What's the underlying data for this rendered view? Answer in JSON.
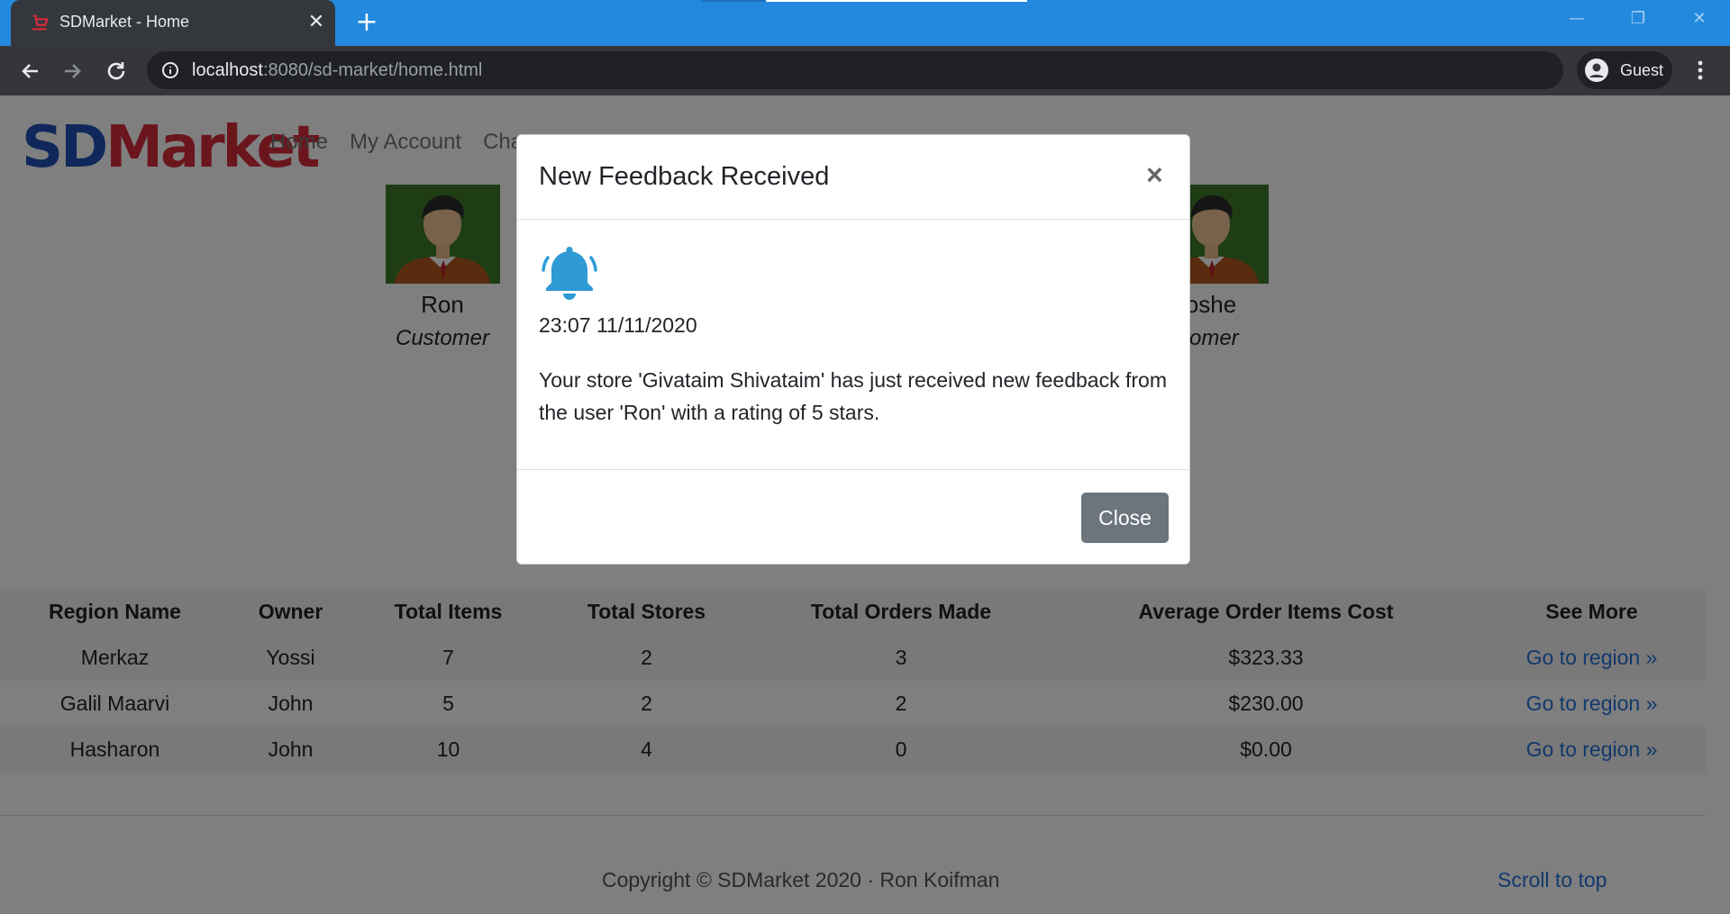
{
  "browser": {
    "tab_title": "SDMarket - Home",
    "url_host": "localhost",
    "url_rest": ":8080/sd-market/home.html",
    "profile_label": "Guest"
  },
  "site": {
    "logo_sd": "SD",
    "logo_market": "Market",
    "nav": [
      "Home",
      "My Account",
      "Cha"
    ]
  },
  "users": [
    {
      "name": "Ron",
      "role": "Customer"
    },
    {
      "name": "oshe",
      "role": "tomer"
    }
  ],
  "modal": {
    "title": "New Feedback Received",
    "time": "23:07 11/11/2020",
    "message": "Your store 'Givataim Shivataim' has just received new feedback from the user 'Ron' with a rating of 5 stars.",
    "close_label": "Close"
  },
  "table": {
    "headers": [
      "Region Name",
      "Owner",
      "Total Items",
      "Total Stores",
      "Total Orders Made",
      "Average Order Items Cost",
      "See More"
    ],
    "rows": [
      [
        "Merkaz",
        "Yossi",
        "7",
        "2",
        "3",
        "$323.33",
        "Go to region »"
      ],
      [
        "Galil Maarvi",
        "John",
        "5",
        "2",
        "2",
        "$230.00",
        "Go to region »"
      ],
      [
        "Hasharon",
        "John",
        "10",
        "4",
        "0",
        "$0.00",
        "Go to region »"
      ]
    ]
  },
  "footer": {
    "copyright": "Copyright © SDMarket 2020 · Ron Koifman",
    "scroll_top": "Scroll to top"
  },
  "colors": {
    "chrome_blue": "#2389de",
    "logo_blue": "#1f4fb5",
    "logo_red": "#d62b3a",
    "link": "#2470d8",
    "bell": "#2e9ad6",
    "button_gray": "#6c757d"
  }
}
